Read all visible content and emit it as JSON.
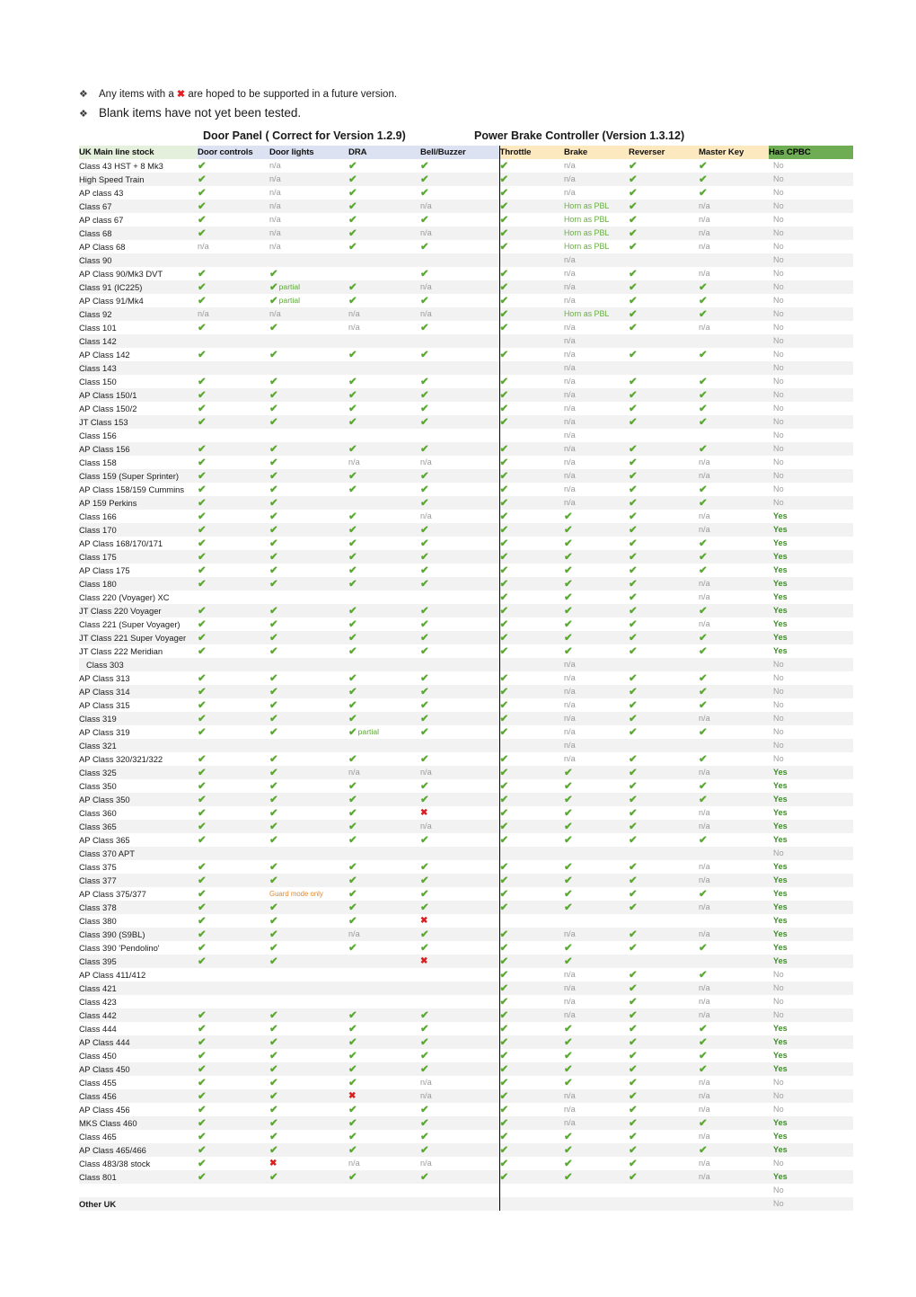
{
  "notes": [
    {
      "bullet": "❖",
      "text_before": "Any items with a ",
      "mark": "✖",
      "text_after": " are hoped to be supported in a future version.",
      "size": "small"
    },
    {
      "bullet": "❖",
      "text_before": "Blank items have not yet been tested.",
      "mark": "",
      "text_after": "",
      "size": "big"
    }
  ],
  "group_titles": {
    "door_panel": "Door Panel ( Correct for Version 1.2.9)",
    "power_brake": "Power Brake Controller (Version 1.3.12)"
  },
  "colors": {
    "name_header_bg": "#e4efdc",
    "door_header_bg": "#dce2f1",
    "pbc_header_bg": "#fde9c0",
    "cpbc_header_bg": "#6fad54",
    "tick_green": "#5aa832",
    "x_red": "#d91f1f",
    "yes_green": "#3f8f29",
    "na_grey": "#9a9a9a",
    "guard_orange": "#e08a2e",
    "row_stripe": "#f2f2f2"
  },
  "headers": [
    "UK Main line stock",
    "Door controls",
    "Door lights",
    "DRA",
    "Bell/Buzzer",
    "Throttle",
    "Brake",
    "Reverser",
    "Master Key",
    "Has CPBC"
  ],
  "footer_label": "Other UK",
  "rows": [
    {
      "name": "Class 43 HST + 8 Mk3",
      "cells": [
        "tick",
        "n/a",
        "tick",
        "tick",
        "tick",
        "n/a",
        "tick",
        "tick",
        "No"
      ]
    },
    {
      "name": "High Speed Train",
      "cells": [
        "tick",
        "n/a",
        "tick",
        "tick",
        "tick",
        "n/a",
        "tick",
        "tick",
        "No"
      ]
    },
    {
      "name": "AP class 43",
      "cells": [
        "tick",
        "n/a",
        "tick",
        "tick",
        "tick",
        "n/a",
        "tick",
        "tick",
        "No"
      ]
    },
    {
      "name": "Class 67",
      "cells": [
        "tick",
        "n/a",
        "tick",
        "n/a",
        "tick",
        "Horn as PBL",
        "tick",
        "n/a",
        "No"
      ]
    },
    {
      "name": "AP class 67",
      "cells": [
        "tick",
        "n/a",
        "tick",
        "tick",
        "tick",
        "Horn as PBL",
        "tick",
        "n/a",
        "No"
      ]
    },
    {
      "name": "Class 68",
      "cells": [
        "tick",
        "n/a",
        "tick",
        "n/a",
        "tick",
        "Horn as PBL",
        "tick",
        "n/a",
        "No"
      ]
    },
    {
      "name": "AP Class 68",
      "cells": [
        "n/a",
        "n/a",
        "tick",
        "tick",
        "tick",
        "Horn as PBL",
        "tick",
        "n/a",
        "No"
      ]
    },
    {
      "name": "Class 90",
      "cells": [
        "",
        "",
        "",
        "",
        "",
        "n/a",
        "",
        "",
        "No"
      ]
    },
    {
      "name": "AP Class 90/Mk3 DVT",
      "cells": [
        "tick",
        "tick",
        "",
        "tick",
        "tick",
        "n/a",
        "tick",
        "n/a",
        "No"
      ]
    },
    {
      "name": "Class 91 (IC225)",
      "cells": [
        "tick",
        "tick+partial",
        "tick",
        "n/a",
        "tick",
        "n/a",
        "tick",
        "tick",
        "No"
      ]
    },
    {
      "name": "AP Class 91/Mk4",
      "cells": [
        "tick",
        "tick+partial",
        "tick",
        "tick",
        "tick",
        "n/a",
        "tick",
        "tick",
        "No"
      ]
    },
    {
      "name": "Class 92",
      "cells": [
        "n/a",
        "n/a",
        "n/a",
        "n/a",
        "tick",
        "Horn as PBL",
        "tick",
        "tick",
        "No"
      ]
    },
    {
      "name": "Class 101",
      "cells": [
        "tick",
        "tick",
        "n/a",
        "tick",
        "tick",
        "n/a",
        "tick",
        "n/a",
        "No"
      ]
    },
    {
      "name": "Class 142",
      "cells": [
        "",
        "",
        "",
        "",
        "",
        "n/a",
        "",
        "",
        "No"
      ]
    },
    {
      "name": "AP Class 142",
      "cells": [
        "tick",
        "tick",
        "tick",
        "tick",
        "tick",
        "n/a",
        "tick",
        "tick",
        "No"
      ]
    },
    {
      "name": "Class 143",
      "cells": [
        "",
        "",
        "",
        "",
        "",
        "n/a",
        "",
        "",
        "No"
      ]
    },
    {
      "name": "Class 150",
      "cells": [
        "tick",
        "tick",
        "tick",
        "tick",
        "tick",
        "n/a",
        "tick",
        "tick",
        "No"
      ]
    },
    {
      "name": "AP Class 150/1",
      "cells": [
        "tick",
        "tick",
        "tick",
        "tick",
        "tick",
        "n/a",
        "tick",
        "tick",
        "No"
      ]
    },
    {
      "name": "AP Class 150/2",
      "cells": [
        "tick",
        "tick",
        "tick",
        "tick",
        "tick",
        "n/a",
        "tick",
        "tick",
        "No"
      ]
    },
    {
      "name": "JT Class 153",
      "cells": [
        "tick",
        "tick",
        "tick",
        "tick",
        "tick",
        "n/a",
        "tick",
        "tick",
        "No"
      ]
    },
    {
      "name": "Class 156",
      "cells": [
        "",
        "",
        "",
        "",
        "",
        "n/a",
        "",
        "",
        "No"
      ]
    },
    {
      "name": "AP Class 156",
      "cells": [
        "tick",
        "tick",
        "tick",
        "tick",
        "tick",
        "n/a",
        "tick",
        "tick",
        "No"
      ]
    },
    {
      "name": "Class 158",
      "cells": [
        "tick",
        "tick",
        "n/a",
        "n/a",
        "tick",
        "n/a",
        "tick",
        "n/a",
        "No"
      ]
    },
    {
      "name": "Class 159 (Super Sprinter)",
      "cells": [
        "tick",
        "tick",
        "tick",
        "tick",
        "tick",
        "n/a",
        "tick",
        "n/a",
        "No"
      ]
    },
    {
      "name": "AP Class 158/159 Cummins",
      "cells": [
        "tick",
        "tick",
        "tick",
        "tick",
        "tick",
        "n/a",
        "tick",
        "tick",
        "No"
      ]
    },
    {
      "name": "AP 159 Perkins",
      "cells": [
        "tick",
        "tick",
        "",
        "tick",
        "tick",
        "n/a",
        "tick",
        "tick",
        "No"
      ]
    },
    {
      "name": "Class 166",
      "cells": [
        "tick",
        "tick",
        "tick",
        "n/a",
        "tick",
        "tick",
        "tick",
        "n/a",
        "Yes"
      ]
    },
    {
      "name": "Class 170",
      "cells": [
        "tick",
        "tick",
        "tick",
        "tick",
        "tick",
        "tick",
        "tick",
        "n/a",
        "Yes"
      ]
    },
    {
      "name": "AP Class 168/170/171",
      "cells": [
        "tick",
        "tick",
        "tick",
        "tick",
        "tick",
        "tick",
        "tick",
        "tick",
        "Yes"
      ]
    },
    {
      "name": "Class 175",
      "cells": [
        "tick",
        "tick",
        "tick",
        "tick",
        "tick",
        "tick",
        "tick",
        "tick",
        "Yes"
      ]
    },
    {
      "name": "AP Class 175",
      "cells": [
        "tick",
        "tick",
        "tick",
        "tick",
        "tick",
        "tick",
        "tick",
        "tick",
        "Yes"
      ]
    },
    {
      "name": "Class 180",
      "cells": [
        "tick",
        "tick",
        "tick",
        "tick",
        "tick",
        "tick",
        "tick",
        "n/a",
        "Yes"
      ]
    },
    {
      "name": "Class 220 (Voyager) XC",
      "cells": [
        "",
        "",
        "",
        "",
        "tick",
        "tick",
        "tick",
        "n/a",
        "Yes"
      ]
    },
    {
      "name": "JT Class 220 Voyager",
      "cells": [
        "tick",
        "tick",
        "tick",
        "tick",
        "tick",
        "tick",
        "tick",
        "tick",
        "Yes"
      ]
    },
    {
      "name": "Class 221 (Super Voyager)",
      "cells": [
        "tick",
        "tick",
        "tick",
        "tick",
        "tick",
        "tick",
        "tick",
        "n/a",
        "Yes"
      ]
    },
    {
      "name": "JT Class 221 Super Voyager",
      "cells": [
        "tick",
        "tick",
        "tick",
        "tick",
        "tick",
        "tick",
        "tick",
        "tick",
        "Yes"
      ]
    },
    {
      "name": "JT Class 222 Meridian",
      "cells": [
        "tick",
        "tick",
        "tick",
        "tick",
        "tick",
        "tick",
        "tick",
        "tick",
        "Yes"
      ]
    },
    {
      "name": "Class 303",
      "indent": true,
      "cells": [
        "",
        "",
        "",
        "",
        "",
        "n/a",
        "",
        "",
        "No"
      ]
    },
    {
      "name": "AP Class 313",
      "cells": [
        "tick",
        "tick",
        "tick",
        "tick",
        "tick",
        "n/a",
        "tick",
        "tick",
        "No"
      ]
    },
    {
      "name": "AP Class 314",
      "cells": [
        "tick",
        "tick",
        "tick",
        "tick",
        "tick",
        "n/a",
        "tick",
        "tick",
        "No"
      ]
    },
    {
      "name": "AP Class 315",
      "cells": [
        "tick",
        "tick",
        "tick",
        "tick",
        "tick",
        "n/a",
        "tick",
        "tick",
        "No"
      ]
    },
    {
      "name": "Class 319",
      "cells": [
        "tick",
        "tick",
        "tick",
        "tick",
        "tick",
        "n/a",
        "tick",
        "n/a",
        "No"
      ]
    },
    {
      "name": "AP Class 319",
      "cells": [
        "tick",
        "tick",
        "tick+partial",
        "tick",
        "tick",
        "n/a",
        "tick",
        "tick",
        "No"
      ]
    },
    {
      "name": "Class 321",
      "cells": [
        "",
        "",
        "",
        "",
        "",
        "n/a",
        "",
        "",
        "No"
      ]
    },
    {
      "name": "AP Class 320/321/322",
      "cells": [
        "tick",
        "tick",
        "tick",
        "tick",
        "tick",
        "n/a",
        "tick",
        "tick",
        "No"
      ]
    },
    {
      "name": "Class 325",
      "cells": [
        "tick",
        "tick",
        "n/a",
        "n/a",
        "tick",
        "tick",
        "tick",
        "n/a",
        "Yes"
      ]
    },
    {
      "name": "Class 350",
      "cells": [
        "tick",
        "tick",
        "tick",
        "tick",
        "tick",
        "tick",
        "tick",
        "tick",
        "Yes"
      ]
    },
    {
      "name": "AP Class 350",
      "cells": [
        "tick",
        "tick",
        "tick",
        "tick",
        "tick",
        "tick",
        "tick",
        "tick",
        "Yes"
      ]
    },
    {
      "name": "Class 360",
      "cells": [
        "tick",
        "tick",
        "tick",
        "x",
        "tick",
        "tick",
        "tick",
        "n/a",
        "Yes"
      ]
    },
    {
      "name": "Class 365",
      "cells": [
        "tick",
        "tick",
        "tick",
        "n/a",
        "tick",
        "tick",
        "tick",
        "n/a",
        "Yes"
      ]
    },
    {
      "name": "AP Class 365",
      "cells": [
        "tick",
        "tick",
        "tick",
        "tick",
        "tick",
        "tick",
        "tick",
        "tick",
        "Yes"
      ]
    },
    {
      "name": "Class 370 APT",
      "cells": [
        "",
        "",
        "",
        "",
        "",
        "",
        "",
        "",
        "No"
      ]
    },
    {
      "name": "Class 375",
      "cells": [
        "tick",
        "tick",
        "tick",
        "tick",
        "tick",
        "tick",
        "tick",
        "n/a",
        "Yes"
      ]
    },
    {
      "name": "Class 377",
      "cells": [
        "tick",
        "tick",
        "tick",
        "tick",
        "tick",
        "tick",
        "tick",
        "n/a",
        "Yes"
      ]
    },
    {
      "name": "AP Class 375/377",
      "cells": [
        "tick",
        "Guard mode only",
        "tick",
        "tick",
        "tick",
        "tick",
        "tick",
        "tick",
        "Yes"
      ]
    },
    {
      "name": "Class 378",
      "cells": [
        "tick",
        "tick",
        "tick",
        "tick",
        "tick",
        "tick",
        "tick",
        "n/a",
        "Yes"
      ]
    },
    {
      "name": "Class 380",
      "cells": [
        "tick",
        "tick",
        "tick",
        "x",
        "",
        "",
        "",
        "",
        "Yes"
      ]
    },
    {
      "name": "Class 390 (S9BL)",
      "cells": [
        "tick",
        "tick",
        "n/a",
        "tick",
        "tick",
        "n/a",
        "tick",
        "n/a",
        "Yes"
      ]
    },
    {
      "name": "Class 390 'Pendolino'",
      "cells": [
        "tick",
        "tick",
        "tick",
        "tick",
        "tick",
        "tick",
        "tick",
        "tick",
        "Yes"
      ]
    },
    {
      "name": "Class 395",
      "cells": [
        "tick",
        "tick",
        "",
        "x",
        "tick",
        "tick",
        "",
        "",
        "Yes"
      ]
    },
    {
      "name": "AP Class 411/412",
      "cells": [
        "",
        "",
        "",
        "",
        "tick",
        "n/a",
        "tick",
        "tick",
        "No"
      ]
    },
    {
      "name": "Class 421",
      "cells": [
        "",
        "",
        "",
        "",
        "tick",
        "n/a",
        "tick",
        "n/a",
        "No"
      ]
    },
    {
      "name": "Class 423",
      "cells": [
        "",
        "",
        "",
        "",
        "tick",
        "n/a",
        "tick",
        "n/a",
        "No"
      ]
    },
    {
      "name": "Class 442",
      "cells": [
        "tick",
        "tick",
        "tick",
        "tick",
        "tick",
        "n/a",
        "tick",
        "n/a",
        "No"
      ]
    },
    {
      "name": "Class 444",
      "cells": [
        "tick",
        "tick",
        "tick",
        "tick",
        "tick",
        "tick",
        "tick",
        "tick",
        "Yes"
      ]
    },
    {
      "name": "AP Class 444",
      "cells": [
        "tick",
        "tick",
        "tick",
        "tick",
        "tick",
        "tick",
        "tick",
        "tick",
        "Yes"
      ]
    },
    {
      "name": "Class 450",
      "cells": [
        "tick",
        "tick",
        "tick",
        "tick",
        "tick",
        "tick",
        "tick",
        "tick",
        "Yes"
      ]
    },
    {
      "name": "AP Class 450",
      "cells": [
        "tick",
        "tick",
        "tick",
        "tick",
        "tick",
        "tick",
        "tick",
        "tick",
        "Yes"
      ]
    },
    {
      "name": "Class 455",
      "cells": [
        "tick",
        "tick",
        "tick",
        "n/a",
        "tick",
        "tick",
        "tick",
        "n/a",
        "No"
      ]
    },
    {
      "name": "Class 456",
      "cells": [
        "tick",
        "tick",
        "x",
        "n/a",
        "tick",
        "n/a",
        "tick",
        "n/a",
        "No"
      ]
    },
    {
      "name": "AP Class 456",
      "cells": [
        "tick",
        "tick",
        "tick",
        "tick",
        "tick",
        "n/a",
        "tick",
        "n/a",
        "No"
      ]
    },
    {
      "name": "MKS Class 460",
      "cells": [
        "tick",
        "tick",
        "tick",
        "tick",
        "tick",
        "n/a",
        "tick",
        "tick",
        "Yes"
      ]
    },
    {
      "name": "Class 465",
      "cells": [
        "tick",
        "tick",
        "tick",
        "tick",
        "tick",
        "tick",
        "tick",
        "n/a",
        "Yes"
      ]
    },
    {
      "name": "AP Class 465/466",
      "cells": [
        "tick",
        "tick",
        "tick",
        "tick",
        "tick",
        "tick",
        "tick",
        "tick",
        "Yes"
      ]
    },
    {
      "name": "Class 483/38 stock",
      "cells": [
        "tick",
        "x",
        "n/a",
        "n/a",
        "tick",
        "tick",
        "tick",
        "n/a",
        "No"
      ]
    },
    {
      "name": "Class 801",
      "cells": [
        "tick",
        "tick",
        "tick",
        "tick",
        "tick",
        "tick",
        "tick",
        "n/a",
        "Yes"
      ]
    },
    {
      "name": "",
      "cells": [
        "",
        "",
        "",
        "",
        "",
        "",
        "",
        "",
        "No"
      ]
    },
    {
      "name": "Other UK",
      "bold": true,
      "cells": [
        "",
        "",
        "",
        "",
        "",
        "",
        "",
        "",
        "No"
      ]
    }
  ]
}
